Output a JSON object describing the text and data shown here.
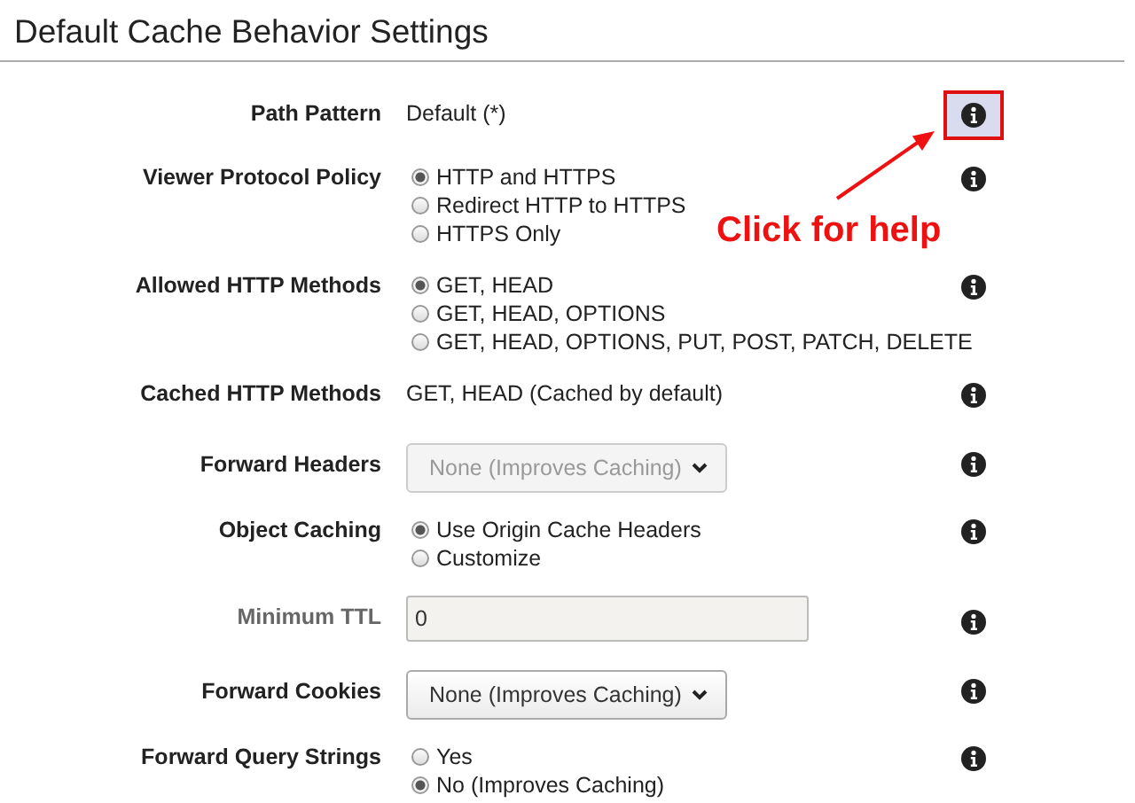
{
  "heading": "Default Cache Behavior Settings",
  "rows": [
    {
      "label": "Path Pattern",
      "kind": "text",
      "value": "Default (*)",
      "help_highlighted": true
    },
    {
      "label": "Viewer Protocol Policy",
      "kind": "radio",
      "help_highlighted": false,
      "options": [
        {
          "label": "HTTP and HTTPS",
          "selected": true
        },
        {
          "label": "Redirect HTTP to HTTPS",
          "selected": false
        },
        {
          "label": "HTTPS Only",
          "selected": false
        }
      ]
    },
    {
      "label": "Allowed HTTP Methods",
      "kind": "radio",
      "help_highlighted": false,
      "options": [
        {
          "label": "GET, HEAD",
          "selected": true
        },
        {
          "label": "GET, HEAD, OPTIONS",
          "selected": false
        },
        {
          "label": "GET, HEAD, OPTIONS, PUT, POST, PATCH, DELETE",
          "selected": false
        }
      ]
    },
    {
      "label": "Cached HTTP Methods",
      "kind": "text",
      "value": "GET, HEAD (Cached by default)",
      "help_highlighted": false
    },
    {
      "label": "Forward Headers",
      "kind": "select",
      "value": "None (Improves Caching)",
      "disabled": true,
      "help_highlighted": false
    },
    {
      "label": "Object Caching",
      "kind": "radio",
      "help_highlighted": false,
      "options": [
        {
          "label": "Use Origin Cache Headers",
          "selected": true
        },
        {
          "label": "Customize",
          "selected": false
        }
      ]
    },
    {
      "label": "Minimum TTL",
      "kind": "input",
      "value": "0",
      "disabled": true,
      "help_highlighted": false
    },
    {
      "label": "Forward Cookies",
      "kind": "select",
      "value": "None (Improves Caching)",
      "disabled": false,
      "help_highlighted": false
    },
    {
      "label": "Forward Query Strings",
      "kind": "radio",
      "help_highlighted": false,
      "options": [
        {
          "label": "Yes",
          "selected": false
        },
        {
          "label": "No (Improves Caching)",
          "selected": true
        }
      ]
    }
  ],
  "annotation": {
    "text": "Click for help"
  }
}
